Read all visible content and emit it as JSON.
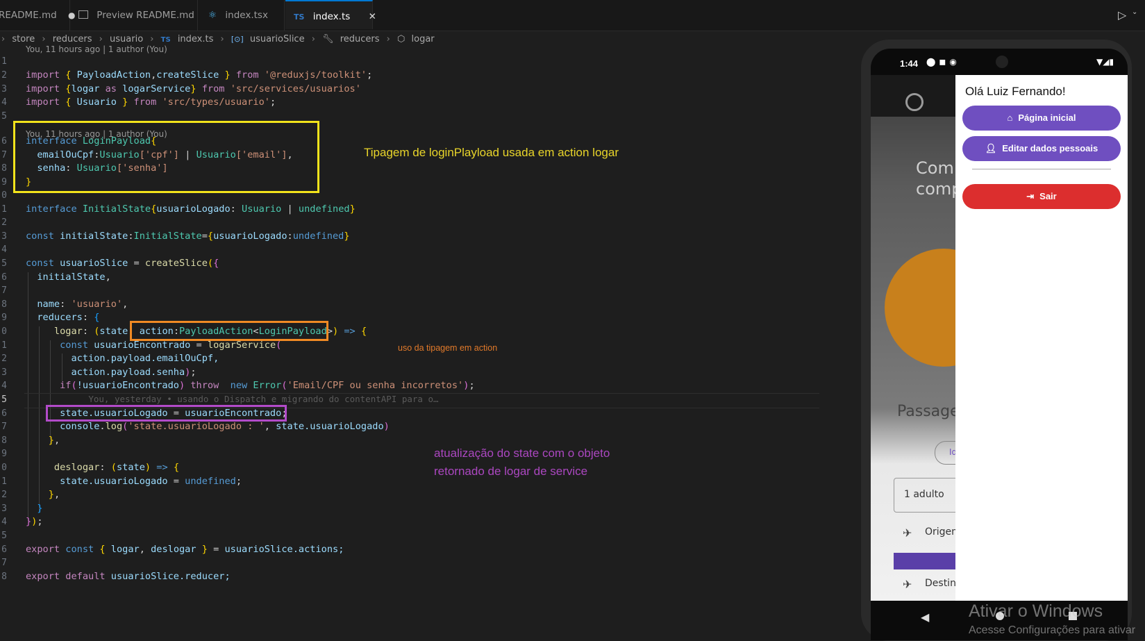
{
  "tabs": [
    {
      "label": "README.md",
      "modified": "●"
    },
    {
      "label": "Preview README.md"
    },
    {
      "label": "index.tsx"
    },
    {
      "label": "index.ts",
      "icon": "TS",
      "close": "✕"
    }
  ],
  "breadcrumb": [
    "store",
    "reducers",
    "usuario",
    "index.ts",
    "usuarioSlice",
    "reducers",
    "logar"
  ],
  "breadcrumb_ts_icon": "TS",
  "codelens_top": "You, 11 hours ago | 1 author (You)",
  "codelens_interface": "You, 11 hours ago | 1 author (You)",
  "line_numbers": [
    "1",
    "2",
    "3",
    "4",
    "5",
    "6",
    "7",
    "8",
    "9",
    "0",
    "1",
    "2",
    "3",
    "4",
    "5",
    "6",
    "7",
    "8",
    "9",
    "0",
    "1",
    "2",
    "3",
    "4",
    "5",
    "6",
    "7",
    "8",
    "9",
    "0",
    "1",
    "2",
    "3",
    "4",
    "5",
    "6",
    "7",
    "8"
  ],
  "code": {
    "l2": {
      "a": "import",
      "b": "{",
      "c": "PayloadAction",
      "d": ",",
      "e": "createSlice",
      "f": "}",
      "g": "from",
      "h": "'@reduxjs/toolkit'",
      "i": ";"
    },
    "l3": {
      "a": "import",
      "b": "{",
      "c": "logar",
      "d": "as",
      "e": "logarService",
      "f": "}",
      "g": "from",
      "h": "'src/services/usuarios'"
    },
    "l4": {
      "a": "import",
      "b": "{",
      "c": "Usuario",
      "f": "}",
      "g": "from",
      "h": "'src/types/usuario'",
      "i": ";"
    },
    "l6": {
      "a": "interface",
      "c": "LoginPayload",
      "b": "{"
    },
    "l7": {
      "a": "emailOuCpf",
      "b": ":",
      "c": "Usuario",
      "d": "['cpf']",
      "e": "|",
      "f": "Usuario",
      "g": "['email']",
      "h": ","
    },
    "l8": {
      "a": "senha",
      "b": ":",
      "c": "Usuario",
      "d": "['senha']"
    },
    "l9": {
      "a": "}"
    },
    "l11": {
      "a": "interface",
      "b": "InitialState",
      "c": "{",
      "d": "usuarioLogado",
      "e": ":",
      "f": "Usuario",
      "g": "|",
      "h": "undefined",
      "i": "}"
    },
    "l13": {
      "a": "const",
      "b": "initialState",
      "c": ":",
      "d": "InitialState",
      "e": "=",
      "f": "{",
      "g": "usuarioLogado",
      "h": ":",
      "i": "undefined",
      "j": "}"
    },
    "l15": {
      "a": "const",
      "b": "usuarioSlice",
      "c": "=",
      "d": "createSlice",
      "e": "(",
      "f": "{"
    },
    "l16": {
      "a": "initialState",
      "b": ","
    },
    "l18": {
      "a": "name",
      "b": ":",
      "c": "'usuario'",
      "d": ","
    },
    "l19": {
      "a": "reducers",
      "b": ":",
      "c": "{"
    },
    "l20": {
      "a": "logar",
      "b": ":",
      "c": "(",
      "d": "state",
      "e": ",",
      "f": "action",
      "g": ":",
      "h": "PayloadAction",
      "i": "<",
      "j": "LoginPayload",
      "k": ">",
      "l": ")",
      "m": "=>",
      "n": "{"
    },
    "l21": {
      "a": "const",
      "b": "usuarioEncontrado",
      "c": "=",
      "d": "logarService",
      "e": "("
    },
    "l22": {
      "a": "action",
      "b": ".payload.emailOuCpf,"
    },
    "l23": {
      "a": "action",
      "b": ".payload.senha",
      "c": ")",
      "d": ";"
    },
    "l24": {
      "a": "if",
      "b": "(",
      "c": "!usuarioEncontrado",
      "d": ")",
      "e": "throw",
      "f": "new",
      "g": "Error",
      "h": "(",
      "i": "'Email/CPF ou senha incorretos'",
      "j": ")",
      "k": ";"
    },
    "l25": {
      "ghost": "You, yesterday • usando o Dispatch e migrando do contentAPI para o…"
    },
    "l26": {
      "a": "state",
      "b": ".usuarioLogado",
      "c": "=",
      "d": "usuarioEncontrado",
      "e": ";"
    },
    "l27": {
      "a": "console",
      "b": ".",
      "c": "log",
      "d": "(",
      "e": "'state.usuarioLogado : '",
      "f": ",",
      "g": "state",
      "h": ".usuarioLogado",
      "i": ")"
    },
    "l28": {
      "a": "}",
      "b": ","
    },
    "l30": {
      "a": "deslogar",
      "b": ":",
      "c": "(",
      "d": "state",
      "e": ")",
      "f": "=>",
      "g": "{"
    },
    "l31": {
      "a": "state",
      "b": ".usuarioLogado",
      "c": "=",
      "d": "undefined",
      "e": ";"
    },
    "l32": {
      "a": "}",
      "b": ","
    },
    "l33": {
      "a": "}"
    },
    "l34": {
      "a": "}",
      "b": ")",
      "c": ";"
    },
    "l36": {
      "a": "export",
      "b": "const",
      "c": "{",
      "d": "logar",
      "e": ",",
      "f": "deslogar",
      "g": "}",
      "h": "=",
      "i": "usuarioSlice",
      "j": ".actions;"
    },
    "l38": {
      "a": "export",
      "b": "default",
      "c": "usuarioSlice",
      "d": ".reducer;"
    }
  },
  "annotations": {
    "tipagem": "Tipagem de loginPlayload usada em action logar",
    "uso": "uso da tipagem em action",
    "atualizacao_1": "atualização do state com o objeto",
    "atualizacao_2": "retornado de logar de service"
  },
  "colors": {
    "yellow": "#f2e31b",
    "orange": "#f08a24",
    "purple": "#b24bc9",
    "drawer_button": "#6f4fc0",
    "sair": "#dc2e2e"
  },
  "phone": {
    "time": "1:44",
    "greeting": "Olá Luiz Fernando!",
    "buttons": [
      {
        "label": "Página inicial",
        "icon": "home-icon"
      },
      {
        "label": "Editar dados pessoais",
        "icon": "person-icon"
      }
    ],
    "logout": "Sair",
    "bg_texts": [
      "Com",
      "comp",
      "Passage",
      "Ida",
      "1 adulto",
      "Origem",
      "Destin"
    ]
  },
  "watermark": {
    "line1": "Ativar o Windows",
    "line2": "Acesse Configurações para ativar"
  }
}
